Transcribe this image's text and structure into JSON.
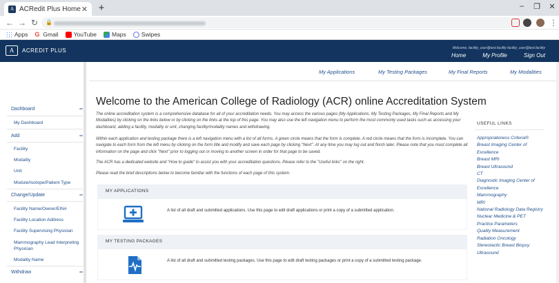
{
  "browser": {
    "tab_title": "ACRedit Plus Home",
    "tab_favicon": "A",
    "new_tab": "+",
    "url_scheme": "",
    "bookmarks": [
      {
        "label": "Apps",
        "icon": "apps-grid-icon",
        "color": "#4285f4"
      },
      {
        "label": "Gmail",
        "icon": "google-icon",
        "color": "#ea4335"
      },
      {
        "label": "YouTube",
        "icon": "youtube-icon",
        "color": "#ff0000"
      },
      {
        "label": "Maps",
        "icon": "maps-icon",
        "color": "#34a853"
      },
      {
        "label": "Swipes",
        "icon": "swipes-icon",
        "color": "#5b6ee1"
      }
    ]
  },
  "header": {
    "logo_mark": "A",
    "app_name": "ACREDIT PLUS",
    "welcome": "Welcome, facility_user@test.facility facility_user@test.facility",
    "nav": [
      "Home",
      "My Profile",
      "Sign Out"
    ],
    "bg_color": "#12345e"
  },
  "sidebar": {
    "sections": [
      {
        "label": "Dashboard",
        "items": [
          "My Dashboard"
        ]
      },
      {
        "label": "Add",
        "items": [
          "Facility",
          "Modality",
          "Unit",
          "Module/Isotope/Patient Type"
        ]
      },
      {
        "label": "Change/Update",
        "items": [
          "Facility Name/Owner/EIN#",
          "Facility Location Address",
          "Facility Supervising Physician",
          "Mammography Lead Interpreting Physician",
          "Modality Name"
        ]
      },
      {
        "label": "Withdraw",
        "items": []
      }
    ],
    "collapse_symbol": "−"
  },
  "subnav": [
    "My Applications",
    "My Testing Packages",
    "My Final Reports",
    "My Modalities"
  ],
  "main": {
    "title": "Welcome to the American College of Radiology (ACR) online Accreditation System",
    "paragraphs": [
      "The online accreditation system is a comprehensive database for all of your accreditation needs. You may access the various pages (My Applications, My Testing Packages, My Final Reports and My Modalities) by clicking on the links below or by clicking on the links at the top of this page. You may also use the left navigation menu to perform the most commonly used tasks such as accessing your dashboard, adding a facility, modality or unit, changing facility/modality names and withdrawing.",
      "Within each application and testing package there is a left navigation menu with a list of all forms. A green circle means that the form is complete. A red circle means that the form is incomplete. You can navigate to each form from the left menu by clicking on the form title and modify and save each page by clicking \"Next\". At any time you may log out and finish later. Please note that you must complete all information on the page and click \"Next\" prior to logging out or moving to another screen in order for that page to be saved.",
      "The ACR has a dedicated website and \"How to guide\" to assist you with your accreditation questions. Please refer to the \"Useful links\" on the right.",
      "Please read the brief descriptions below to become familiar with the functions of each page of this system."
    ],
    "cards": [
      {
        "title": "MY APPLICATIONS",
        "icon": "computer-add-icon",
        "text": "A list of all draft and submitted applications. Use this page to edit draft applications or print a copy of a submitted application."
      },
      {
        "title": "MY TESTING PACKAGES",
        "icon": "file-waveform-icon",
        "text": "A list of all draft and submitted testing packages. Use this page to edit draft testing packages or print a copy of a submitted testing package."
      }
    ],
    "accent_color": "#1f6fc5"
  },
  "useful_links": {
    "title": "USEFUL LINKS",
    "items": [
      "Appropriateness Criteria®",
      "Breast Imaging Center of Excellence",
      "Breast MRI",
      "Breast Ultrasound",
      "CT",
      "Diagnostic Imaging Center of Excellence",
      "Mammography",
      "MRI",
      "National Radiology Data Registry",
      "Nuclear Medicine & PET",
      "Practice Parameters",
      "Quality Measurement",
      "Radiation Oncology",
      "Stereotactic Breast Biopsy",
      "Ultrasound"
    ]
  }
}
